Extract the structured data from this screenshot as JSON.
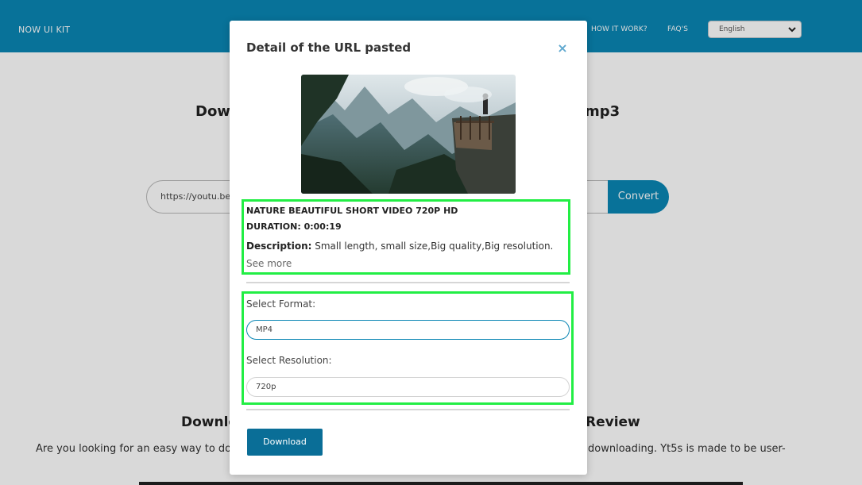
{
  "navbar": {
    "brand": "NOW UI KIT",
    "links": [
      "HOW IT WORK?",
      "FAQ'S"
    ],
    "language": "English"
  },
  "page": {
    "hero_left": "Dow",
    "hero_right": "mp3",
    "url_value": "https://youtu.be/",
    "convert_label": "Convert",
    "section_left": "Downlo",
    "section_right": "Review",
    "para_left": "Are you looking for an easy way to dow",
    "para_right": "downloading. Yt5s is made to be user-"
  },
  "modal": {
    "title": "Detail of the URL pasted",
    "close": "×",
    "video_title": "NATURE BEAUTIFUL SHORT VIDEO 720P HD",
    "duration_label": "DURATION: ",
    "duration_value": "0:00:19",
    "description_label": "Description:",
    "description_text": " Small length, small size,Big quality,Big resolution.",
    "see_more": "See more",
    "format_label": "Select Format:",
    "format_value": "MP4",
    "resolution_label": "Select Resolution:",
    "resolution_value": "720p",
    "download_label": "Download"
  },
  "colors": {
    "brand": "#0a86b4",
    "highlight": "#22ee44",
    "download": "#0a6e97"
  }
}
